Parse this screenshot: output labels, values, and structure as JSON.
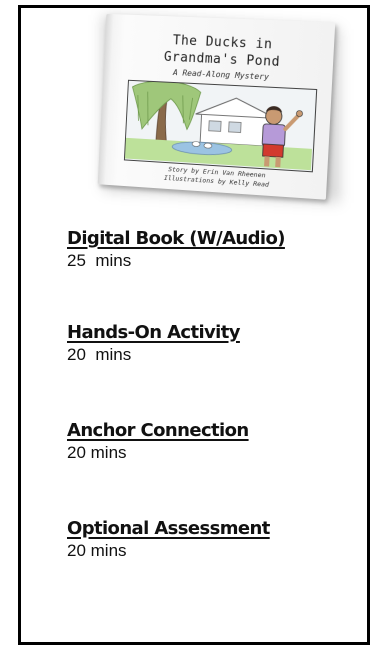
{
  "book": {
    "title_line1": "The Ducks in",
    "title_line2": "Grandma's Pond",
    "subtitle": "A Read-Along Mystery",
    "story_credit": "Story by Erin Van Rheenen",
    "illustration_credit": "Illustrations by Kelly Read"
  },
  "activities": [
    {
      "title": "Digital Book (W/Audio)",
      "duration": "25  mins"
    },
    {
      "title": "Hands-On Activity",
      "duration": "20  mins"
    },
    {
      "title": "Anchor Connection",
      "duration": "20 mins"
    },
    {
      "title": "Optional Assessment",
      "duration": "20 mins"
    }
  ],
  "colors": {
    "border": "#000000",
    "text": "#111111",
    "shirt": "#b69ad8",
    "shorts": "#d23a2e"
  }
}
